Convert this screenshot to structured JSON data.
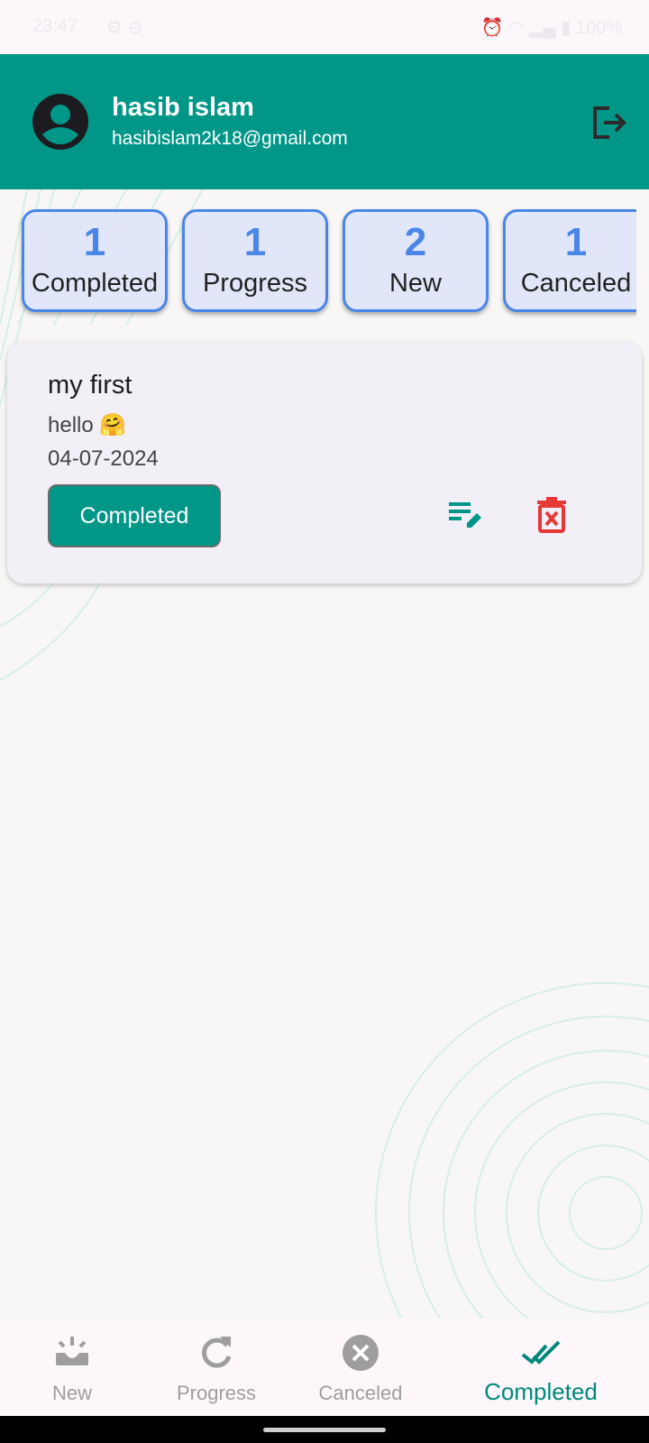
{
  "status_bar": {
    "time": "23:47",
    "battery": "100%"
  },
  "header": {
    "user_name": "hasib islam",
    "user_email": "hasibislam2k18@gmail.com",
    "avatar_icon": "account-circle-icon",
    "logout_icon": "logout-icon",
    "background_color": "#009688"
  },
  "summary": [
    {
      "count": "1",
      "label": "Completed"
    },
    {
      "count": "1",
      "label": "Progress"
    },
    {
      "count": "2",
      "label": "New"
    },
    {
      "count": "1",
      "label": "Canceled"
    }
  ],
  "task": {
    "title": "my first",
    "description": "hello 🤗",
    "date": "04-07-2024",
    "status": "Completed",
    "edit_icon": "edit-note-icon",
    "delete_icon": "delete-icon"
  },
  "bottom_nav": {
    "items": [
      {
        "label": "New",
        "icon": "new-task-icon"
      },
      {
        "label": "Progress",
        "icon": "refresh-icon"
      },
      {
        "label": "Canceled",
        "icon": "cancel-icon"
      },
      {
        "label": "Completed",
        "icon": "done-all-icon"
      }
    ],
    "active_index": 3
  },
  "colors": {
    "accent": "#009688",
    "summary_blue": "#4a86e8",
    "delete_red": "#e53935"
  }
}
